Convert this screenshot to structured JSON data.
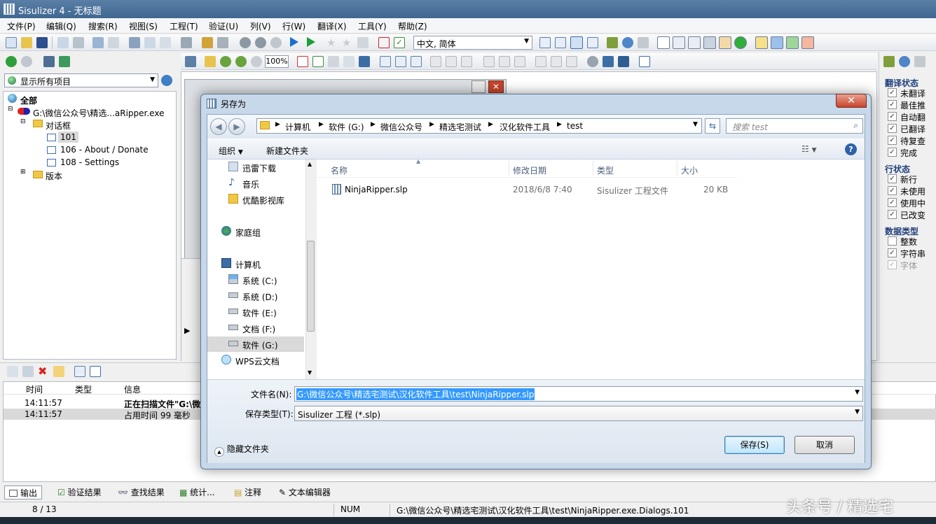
{
  "window": {
    "title": "Sisulizer 4 - 无标题"
  },
  "menu": [
    "文件(P)",
    "编辑(Q)",
    "搜索(R)",
    "视图(S)",
    "工程(T)",
    "验证(U)",
    "列(V)",
    "行(W)",
    "翻译(X)",
    "工具(Y)",
    "帮助(Z)"
  ],
  "toolbar": {
    "language": "中文, 简体",
    "zoom": "100%"
  },
  "tree": {
    "filter": "显示所有项目",
    "root": "全部",
    "project": "G:\\微信公众号\\精选...aRipper.exe",
    "dialogs": "对话框",
    "items": [
      "101",
      "106 - About / Donate",
      "108 - Settings"
    ],
    "version": "版本"
  },
  "sidebar": {
    "sections": [
      {
        "title": "翻译状态",
        "items": [
          "未翻译",
          "最佳推",
          "自动翻",
          "已翻译",
          "待复查",
          "完成"
        ]
      },
      {
        "title": "行状态",
        "items": [
          "新行",
          "未使用",
          "使用中",
          "已改变"
        ]
      },
      {
        "title": "数据类型",
        "items": [
          "整数",
          "字符串",
          "字体"
        ]
      }
    ]
  },
  "log": {
    "headers": [
      "时间",
      "类型",
      "信息"
    ],
    "rows": [
      {
        "time": "14:11:57",
        "type": "",
        "info": "正在扫描文件\"G:\\微"
      },
      {
        "time": "14:11:57",
        "type": "",
        "info": "占用时间 99 毫秒"
      }
    ]
  },
  "bottom_tabs": [
    "输出",
    "验证结果",
    "查找结果",
    "统计...",
    "注释",
    "文本编辑器"
  ],
  "status": {
    "position": "8 / 13",
    "num": "NUM",
    "path": "G:\\微信公众号\\精选宅测试\\汉化软件工具\\test\\NinjaRipper.exe.Dialogs.101"
  },
  "dialog": {
    "title": "另存为",
    "breadcrumb": [
      "计算机",
      "软件 (G:)",
      "微信公众号",
      "精选宅测试",
      "汉化软件工具",
      "test"
    ],
    "search_placeholder": "搜索 test",
    "organize": "组织",
    "new_folder": "新建文件夹",
    "nav": [
      "迅雷下载",
      "音乐",
      "优酷影视库",
      "家庭组",
      "计算机",
      "系统 (C:)",
      "系统 (D:)",
      "软件 (E:)",
      "文档 (F:)",
      "软件 (G:)",
      "WPS云文档"
    ],
    "columns": [
      "名称",
      "修改日期",
      "类型",
      "大小"
    ],
    "files": [
      {
        "name": "NinjaRipper.slp",
        "date": "2018/6/8 7:40",
        "type": "Sisulizer 工程文件",
        "size": "20 KB"
      }
    ],
    "filename_label": "文件名(N):",
    "filename_value": "G:\\微信公众号\\精选宅测试\\汉化软件工具\\test\\NinjaRipper.slp",
    "filetype_label": "保存类型(T):",
    "filetype_value": "Sisulizer 工程 (*.slp)",
    "hide_folders": "隐藏文件夹",
    "save": "保存(S)",
    "cancel": "取消"
  },
  "watermark": "头条号 / 精选宅"
}
